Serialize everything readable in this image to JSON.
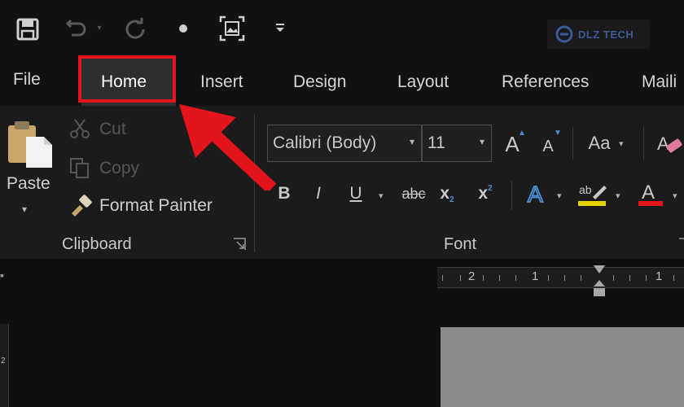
{
  "qat": {
    "icons": [
      "save-icon",
      "undo-icon",
      "redo-icon",
      "bullet-icon",
      "screenshot-icon",
      "customize-icon"
    ]
  },
  "logo": {
    "text": "DLZ TECH"
  },
  "tabs": [
    "File",
    "Home",
    "Insert",
    "Design",
    "Layout",
    "References",
    "Maili"
  ],
  "active_tab": "Home",
  "clipboard": {
    "paste_label": "Paste",
    "cut_label": "Cut",
    "copy_label": "Copy",
    "format_painter_label": "Format Painter",
    "group_label": "Clipboard"
  },
  "font": {
    "font_name": "Calibri (Body)",
    "font_size": "11",
    "change_case_label": "Aa",
    "group_label": "Font",
    "buttons": [
      "B",
      "I",
      "U",
      "abc",
      "x",
      "x"
    ]
  },
  "ruler": {
    "numbers": [
      "2",
      "1",
      "1"
    ]
  },
  "colors": {
    "highlight_box": "#e3141b",
    "arrow": "#e3141b",
    "highlight_bar": "#e6d400",
    "font_color_bar": "#e3141b"
  }
}
